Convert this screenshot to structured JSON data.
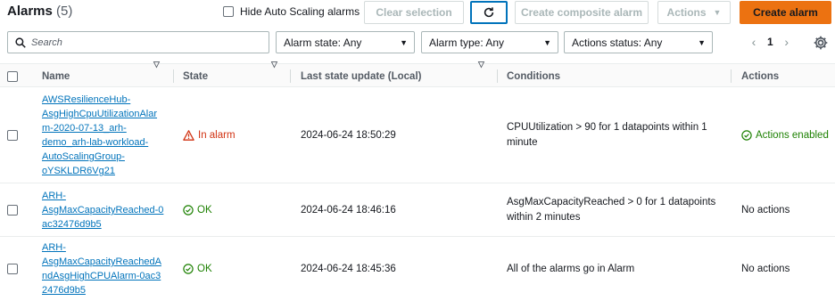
{
  "header": {
    "title": "Alarms",
    "count": "(5)",
    "hide_autoscaling_label": "Hide Auto Scaling alarms",
    "clear_selection": "Clear selection",
    "create_composite": "Create composite alarm",
    "actions": "Actions",
    "create_alarm": "Create alarm"
  },
  "filters": {
    "search_placeholder": "Search",
    "alarm_state": "Alarm state: Any",
    "alarm_type": "Alarm type: Any",
    "actions_status": "Actions status: Any"
  },
  "pagination": {
    "page": "1"
  },
  "columns": {
    "name": "Name",
    "state": "State",
    "last_update": "Last state update (Local)",
    "conditions": "Conditions",
    "actions": "Actions"
  },
  "rows": [
    {
      "name_lines": [
        "AWSResilienceHub-",
        "AsgHighCpuUtilizationAlar",
        "m-2020-07-13_arh-",
        "demo_arh-lab-workload-",
        "AutoScalingGroup-",
        "oYSKLDR6Vg21"
      ],
      "state": "In alarm",
      "updated": "2024-06-24 18:50:29",
      "condition_lines": [
        "CPUUtilization > 90 for 1 datapoints within 1",
        "minute"
      ],
      "actions": "Actions enabled"
    },
    {
      "name_lines": [
        "ARH-",
        "AsgMaxCapacityReached-0",
        "ac32476d9b5"
      ],
      "state": "OK",
      "updated": "2024-06-24 18:46:16",
      "condition_lines": [
        "AsgMaxCapacityReached > 0 for 1 datapoints",
        "within 2 minutes"
      ],
      "actions": "No actions"
    },
    {
      "name_lines": [
        "ARH-",
        "AsgMaxCapacityReachedA",
        "ndAsgHighCPUAlarm-0ac3",
        "2476d9b5"
      ],
      "state": "OK",
      "updated": "2024-06-24 18:45:36",
      "condition_lines": [
        "All of the alarms go in Alarm"
      ],
      "actions": "No actions"
    }
  ],
  "colors": {
    "accent": "#ec7211",
    "link": "#0073bb",
    "alarm": "#d13212",
    "ok": "#1d8102"
  },
  "icons": [
    "refresh-icon",
    "search-icon",
    "gear-icon",
    "warning-icon",
    "check-circle-icon"
  ]
}
